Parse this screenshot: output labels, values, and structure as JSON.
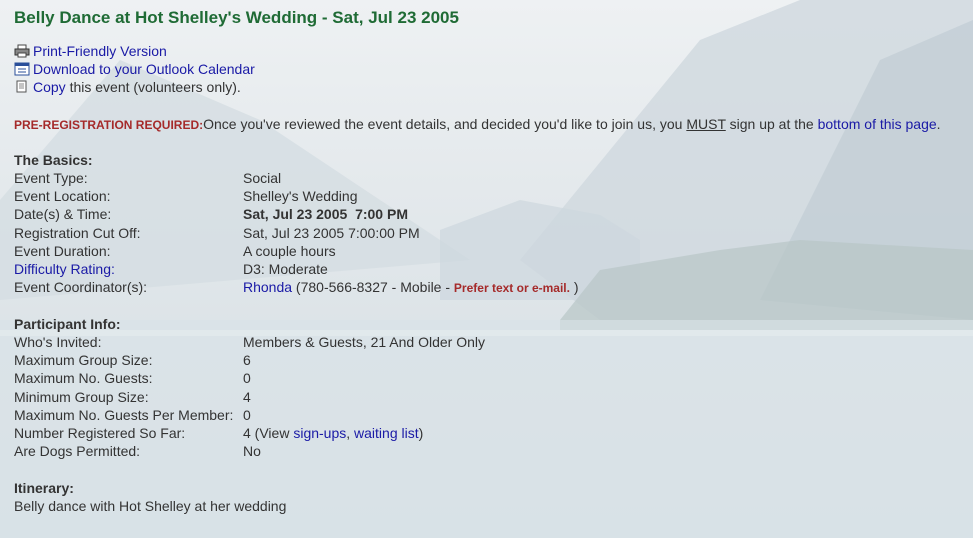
{
  "title": "Belly Dance at Hot Shelley's Wedding - Sat, Jul 23 2005",
  "links": {
    "print": "Print-Friendly Version",
    "outlook": "Download to your Outlook Calendar",
    "copy_link": "Copy",
    "copy_rest": " this event (volunteers only)."
  },
  "prereg": {
    "required": "PRE-REGISTRATION REQUIRED:",
    "text1": "Once you've reviewed the event details, and decided you'd like to join us, you ",
    "must": "MUST",
    "text2": " sign up at the ",
    "bottom_link": "bottom of this page",
    "end": "."
  },
  "basics": {
    "heading": "The Basics:",
    "event_type_label": "Event Type:",
    "event_type": "Social",
    "location_label": "Event Location:",
    "location": "Shelley's Wedding",
    "datetime_label": "Date(s) & Time:",
    "datetime": "Sat, Jul 23 2005  7:00 PM",
    "cutoff_label": "Registration Cut Off:",
    "cutoff": "Sat, Jul 23 2005 7:00:00 PM",
    "duration_label": "Event Duration:",
    "duration": "A couple hours",
    "difficulty_label": "Difficulty Rating:",
    "difficulty": "D3: Moderate",
    "coordinator_label": "Event Coordinator(s):",
    "coordinator_name": "Rhonda",
    "coordinator_phone": " (780-566-8327 - Mobile - ",
    "coordinator_pref": "Prefer text or e-mail.",
    "coordinator_end": " )"
  },
  "participant": {
    "heading": "Participant Info:",
    "invited_label": "Who's Invited:",
    "invited": "Members & Guests, 21 And Older Only",
    "max_group_label": "Maximum Group Size:",
    "max_group": "6",
    "max_guests_label": "Maximum No. Guests:",
    "max_guests": "0",
    "min_group_label": "Minimum Group Size:",
    "min_group": "4",
    "guests_per_label": "Maximum No. Guests Per Member:",
    "guests_per": "0",
    "registered_label": "Number Registered So Far:",
    "registered_count": "4 (View ",
    "signups_link": "sign-ups",
    "comma": ", ",
    "waiting_link": "waiting list",
    "close": ")",
    "dogs_label": "Are Dogs Permitted:",
    "dogs": "No"
  },
  "itinerary": {
    "heading": "Itinerary:",
    "text": "Belly dance with Hot Shelley at her wedding"
  }
}
